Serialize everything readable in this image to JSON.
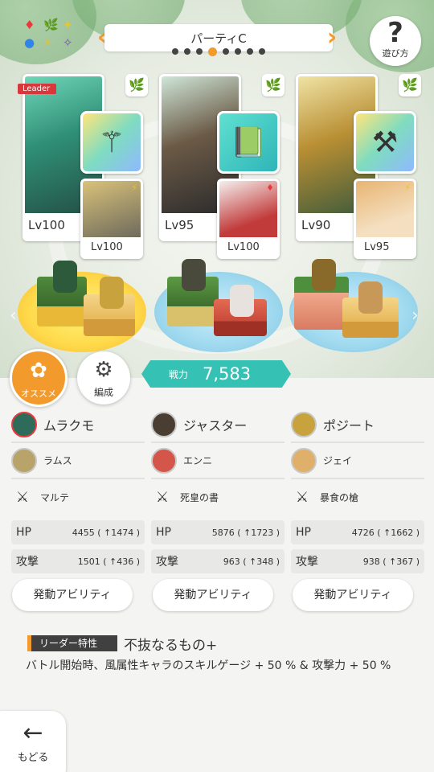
{
  "header": {
    "party_title": "パーティC",
    "page_dots": 8,
    "active_dot": 3,
    "help_label": "遊び方",
    "element_icons": [
      "♦",
      "🌿",
      "✦",
      "●",
      "⚡",
      "✧"
    ]
  },
  "cards": [
    {
      "level": "Lv100",
      "leader_badge": "Leader",
      "attribute_icon": "🌿",
      "weapon_icon": "⚚",
      "sub_level": "Lv100",
      "sub_attribute_icon": "⚡"
    },
    {
      "level": "Lv95",
      "attribute_icon": "🌿",
      "weapon_icon": "📗",
      "sub_level": "Lv100",
      "sub_attribute_icon": "♦"
    },
    {
      "level": "Lv90",
      "attribute_icon": "🌿",
      "weapon_icon": "⚒",
      "sub_level": "Lv95",
      "sub_attribute_icon": "⚡"
    }
  ],
  "buttons": {
    "osusume": "オススメ",
    "hensei": "編成",
    "back": "もどる"
  },
  "power": {
    "label": "戦力",
    "value": "7,583"
  },
  "columns": [
    {
      "main_name": "ムラクモ",
      "sub_name": "ラムス",
      "weapon_name": "マルテ",
      "hp_label": "HP",
      "hp": "4455 ( ↑1474 )",
      "atk_label": "攻撃",
      "atk": "1501 ( ↑436 )",
      "ability": "発動アビリティ"
    },
    {
      "main_name": "ジャスター",
      "sub_name": "エンニ",
      "weapon_name": "死皇の書",
      "hp_label": "HP",
      "hp": "5876 ( ↑1723 )",
      "atk_label": "攻撃",
      "atk": "963 ( ↑348 )",
      "ability": "発動アビリティ"
    },
    {
      "main_name": "ポジート",
      "sub_name": "ジェイ",
      "weapon_name": "暴食の槍",
      "hp_label": "HP",
      "hp": "4726 ( ↑1662 )",
      "atk_label": "攻撃",
      "atk": "938 ( ↑367 )",
      "ability": "発動アビリティ"
    }
  ],
  "leader_trait": {
    "tag": "リーダー特性",
    "name": "不抜なるもの+",
    "description": "バトル開始時、風属性キャラのスキルゲージ + 50 % & 攻撃力 + 50 %"
  },
  "colors": {
    "accent": "#f39a2c",
    "power_bg": "#36c1b5",
    "leader_red": "#d8373b"
  }
}
